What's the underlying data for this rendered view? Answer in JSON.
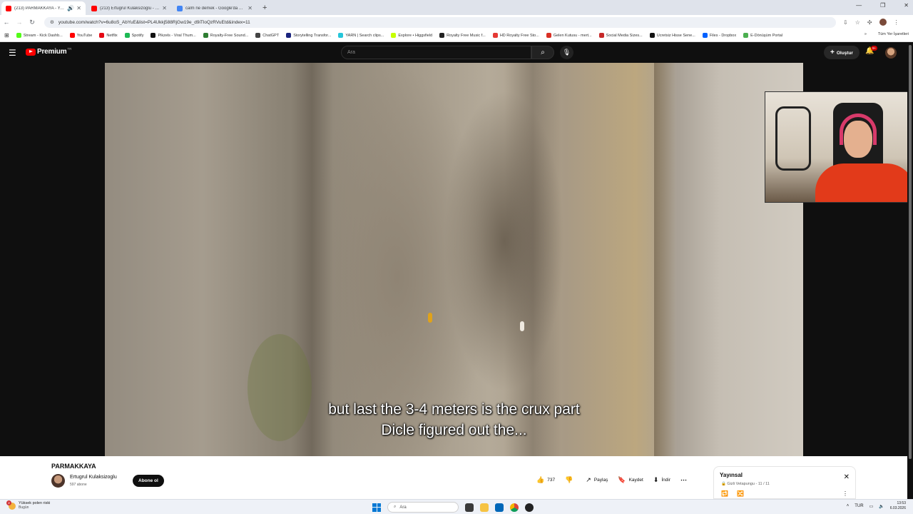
{
  "browser": {
    "tabs": [
      {
        "title": "(213) PARMAKKAYA - YouT...",
        "active": true,
        "favicon_color": "#ff0000"
      },
      {
        "title": "(213) Ertugrul Kulaksizoglu - Yo...",
        "active": false,
        "favicon_color": "#ff0000"
      },
      {
        "title": "calm ne demek - Google'da Ar...",
        "active": false,
        "favicon_color": "#4285f4"
      }
    ],
    "new_tab_label": "+",
    "url": "youtube.com/watch?v=6u8oS_AbYuE&list=PL4Ukkj588RjGw19e_d9iTloQzRVuEtd&index=11",
    "bookmarks": [
      {
        "label": "Stream - Kick Dashb...",
        "color": "#53fc18"
      },
      {
        "label": "YouTube",
        "color": "#ff0000"
      },
      {
        "label": "Netflix",
        "color": "#e50914"
      },
      {
        "label": "Spotify",
        "color": "#1db954"
      },
      {
        "label": "Pikzels - Viral Thum...",
        "color": "#111111"
      },
      {
        "label": "Royalty-Free Sound...",
        "color": "#2e7d32"
      },
      {
        "label": "ChatGPT",
        "color": "#444444"
      },
      {
        "label": "Storytelling Transfor...",
        "color": "#1a237e"
      },
      {
        "label": "YARN | Search clips...",
        "color": "#26c6da"
      },
      {
        "label": "Explore • Higgsfield",
        "color": "#c6ff00"
      },
      {
        "label": "Royalty Free Music f...",
        "color": "#212121"
      },
      {
        "label": "HD Royalty Free Sto...",
        "color": "#e53935"
      },
      {
        "label": "Gelen Kutusu - mert...",
        "color": "#d93025"
      },
      {
        "label": "Social Media Sizes...",
        "color": "#c62828"
      },
      {
        "label": "Ucretsiz Hisse Sene...",
        "color": "#111111"
      },
      {
        "label": "Files - Dropbox",
        "color": "#0061ff"
      },
      {
        "label": "E-Dönüşüm Portal",
        "color": "#4caf50"
      }
    ],
    "bookmarks_more": "»",
    "all_bookmarks_label": "Tüm Yer İşaretleri"
  },
  "youtube": {
    "logo_text": "Premium",
    "logo_sup": "TR",
    "search_placeholder": "Ara",
    "create_label": "Oluştur",
    "notification_count": "9+"
  },
  "video": {
    "caption_line1": "but last the 3-4 meters is the crux part",
    "caption_line2": "Dicle figured out the...",
    "title": "PARMAKKAYA",
    "channel_name": "Ertugrul Kulaksizoglu",
    "subscribers": "597 abone",
    "subscribe_label": "Abone ol",
    "likes": "737",
    "share_label": "Paylaş",
    "save_label": "Kaydet",
    "download_label": "İndir"
  },
  "playlist": {
    "title": "Yayınsal",
    "privacy": "Gizli",
    "owner": "Vetapungu",
    "position": "11 / 11"
  },
  "taskbar": {
    "weather_line1": "Yüksek polen riski",
    "weather_line2": "Bugün",
    "weather_badge": "2",
    "search_placeholder": "Ara",
    "language": "TUR",
    "time": "13:53",
    "date": "6.03.2026"
  }
}
